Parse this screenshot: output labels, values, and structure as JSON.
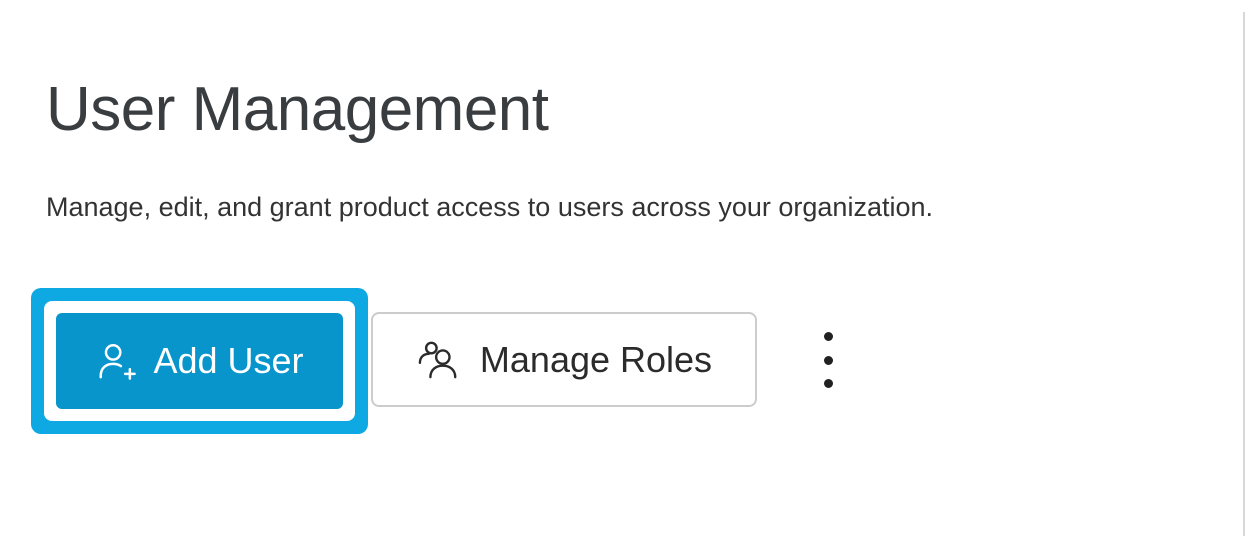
{
  "page": {
    "title": "User Management",
    "subtitle": "Manage, edit, and grant product access to users across your organization."
  },
  "toolbar": {
    "add_user": {
      "label": "Add User",
      "icon": "user-plus-icon"
    },
    "manage_roles": {
      "label": "Manage Roles",
      "icon": "users-icon"
    },
    "more_options": {
      "icon": "kebab-menu-icon"
    }
  },
  "colors": {
    "primary_button_bg": "#0795cc",
    "primary_button_text": "#ffffff",
    "focus_ring": "#0ea9e2",
    "secondary_button_border": "#cccccc",
    "secondary_button_text": "#2b2b2b",
    "title_text": "#3a3d40",
    "body_text": "#333333",
    "divider": "#d8d8d8",
    "kebab_dot": "#212121"
  }
}
